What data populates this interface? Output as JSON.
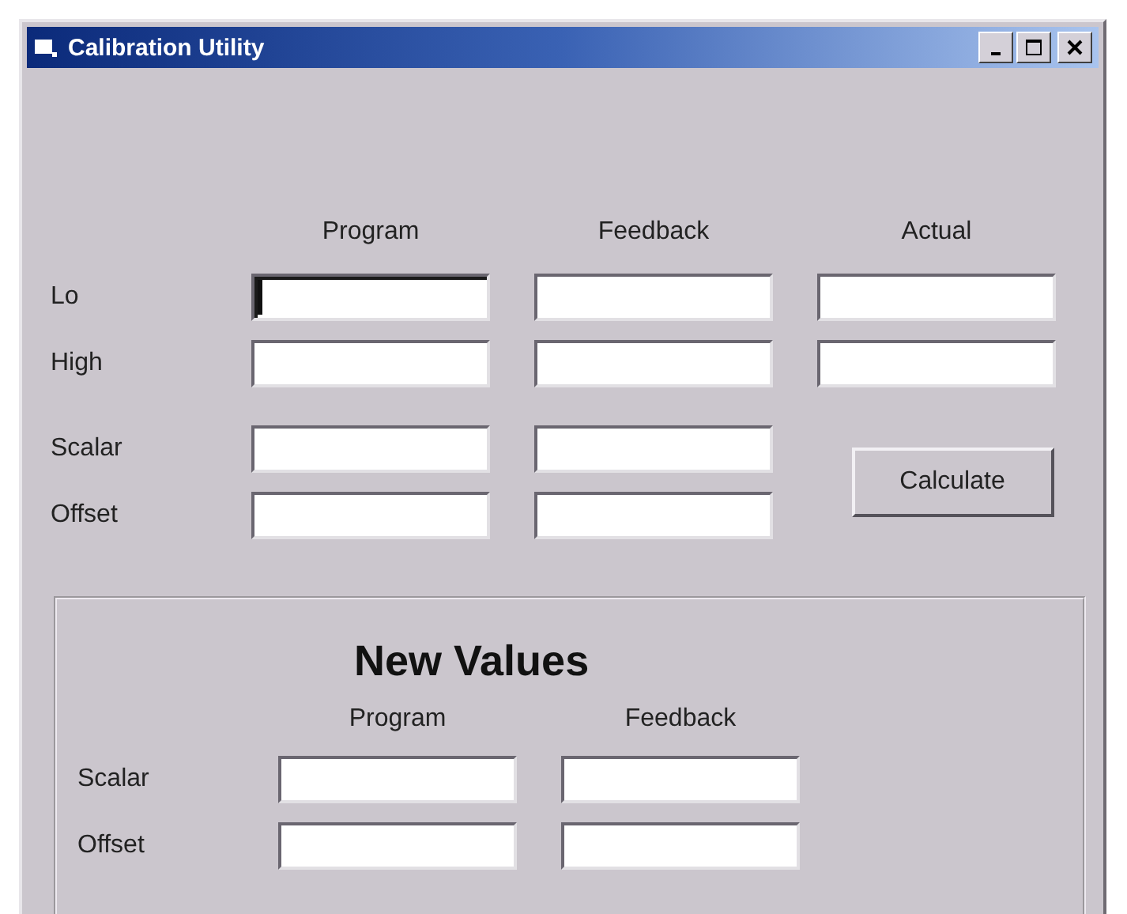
{
  "window": {
    "title": "Calibration Utility"
  },
  "input": {
    "columns": [
      "Program",
      "Feedback",
      "Actual"
    ],
    "rows": [
      {
        "label": "Lo",
        "fields": [
          {
            "focused": true
          },
          {
            "focused": false
          },
          {
            "focused": false
          }
        ]
      },
      {
        "label": "High",
        "fields": [
          {
            "focused": false
          },
          {
            "focused": false
          },
          {
            "focused": false
          }
        ]
      }
    ]
  },
  "factors": {
    "rows": [
      {
        "label": "Scalar",
        "fields": [
          {
            "focused": false
          },
          {
            "focused": false
          }
        ]
      },
      {
        "label": "Offset",
        "fields": [
          {
            "focused": false
          },
          {
            "focused": false
          }
        ]
      }
    ],
    "button": "Calculate"
  },
  "new_values": {
    "title": "New Values",
    "columns": [
      "Program",
      "Feedback"
    ],
    "rows": [
      {
        "label": "Scalar",
        "fields": [
          {
            "focused": false
          },
          {
            "focused": false
          }
        ]
      },
      {
        "label": "Offset",
        "fields": [
          {
            "focused": false
          },
          {
            "focused": false
          }
        ]
      }
    ]
  }
}
